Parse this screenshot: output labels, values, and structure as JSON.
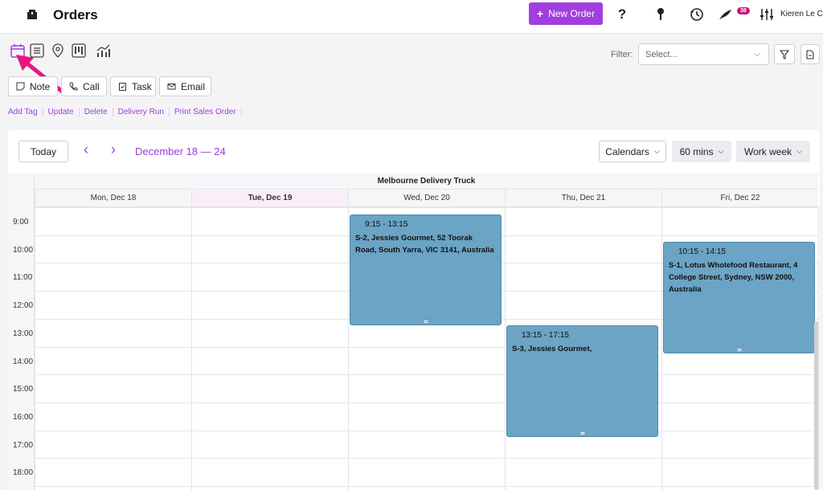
{
  "header": {
    "title": "Orders",
    "new_order_label": "New Order",
    "notification_count": "38",
    "user_name": "Kieren Le C"
  },
  "filter": {
    "label": "Filter:",
    "placeholder": "Select..."
  },
  "actions": {
    "note": "Note",
    "call": "Call",
    "task": "Task",
    "email": "Email"
  },
  "links": [
    "Add Tag",
    "Update",
    "Delete",
    "Delivery Run",
    "Print Sales Order"
  ],
  "calendar": {
    "today_label": "Today",
    "range": "December 18 — 24",
    "calendars_label": "Calendars",
    "interval_label": "60 mins",
    "view_label": "Work week",
    "resource": "Melbourne Delivery Truck",
    "days": [
      "Mon, Dec 18",
      "Tue, Dec 19",
      "Wed, Dec 20",
      "Thu, Dec 21",
      "Fri, Dec 22"
    ],
    "today_index": 1,
    "times": [
      "9:00",
      "10:00",
      "11:00",
      "12:00",
      "13:00",
      "14:00",
      "15:00",
      "16:00",
      "17:00",
      "18:00"
    ],
    "events": [
      {
        "day": 2,
        "start": 9.25,
        "end": 13.25,
        "time": "9:15 - 13:15",
        "title": "S-2, Jessies Gourmet, 52 Toorak Road, South Yarra, VIC 3141, Australia"
      },
      {
        "day": 4,
        "start": 10.25,
        "end": 14.25,
        "time": "10:15 - 14:15",
        "title": "S-1, Lotus Wholefood Restaurant, 4 College Street, Sydney, NSW 2000, Australia"
      },
      {
        "day": 3,
        "start": 13.25,
        "end": 17.25,
        "time": "13:15 - 17:15",
        "title": "S-3, Jessies Gourmet,"
      }
    ]
  },
  "colors": {
    "accent": "#a23ee0",
    "event": "#6ba4c4",
    "annotation_arrow": "#e8177d"
  }
}
